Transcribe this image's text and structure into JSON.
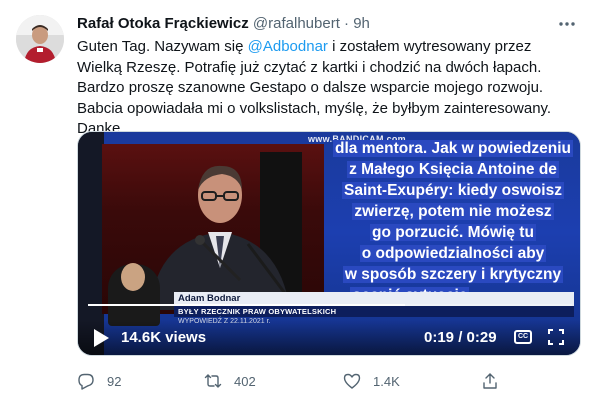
{
  "tweet": {
    "author_name": "Rafał Otoka Frąckiewicz",
    "handle": "@rafalhubert",
    "separator": "·",
    "time": "9h",
    "text_before": "Guten Tag. Nazywam się ",
    "mention": "@Adbodnar",
    "text_after": " i zostałem wytresowany przez Wielką Rzeszę. Potrafię już czytać z kartki i chodzić na dwóch łapach. Bardzo proszę szanowne Gestapo o dalsze wsparcie mojego rozwoju. Babcia opowiadała mi o volkslistach, myślę, że byłbym zainteresowany. Danke.",
    "more_icon": "ellipsis-icon"
  },
  "video": {
    "watermark": "www.BANDICAM.com",
    "caption_lines": [
      "dla mentora. Jak w powiedzeniu",
      "z Małego Księcia Antoine de",
      "Saint-Exupéry: kiedy oswoisz",
      "zwierzę, potem nie możesz",
      "go porzucić. Mówię tu",
      "o odpowiedzialności aby",
      "w sposób szczery i krytyczny",
      "ocenić sytuację"
    ],
    "lower_third_name": "Adam Bodnar",
    "lower_third_role": "BYŁY RZECZNIK PRAW OBYWATELSKICH",
    "lower_third_date": "WYPOWIEDŹ Z 22.11.2021 r.",
    "views": "14.6K views",
    "time_current": "0:19",
    "time_separator": "/",
    "time_total": "0:29",
    "progress": 0.655,
    "cc_label": "CC"
  },
  "actions": {
    "reply_count": "92",
    "retweet_count": "402",
    "like_count": "1.4K"
  },
  "colors": {
    "accent": "#1d9bf0",
    "secondary_text": "#536471",
    "video_blue": "#1c3fb0"
  }
}
